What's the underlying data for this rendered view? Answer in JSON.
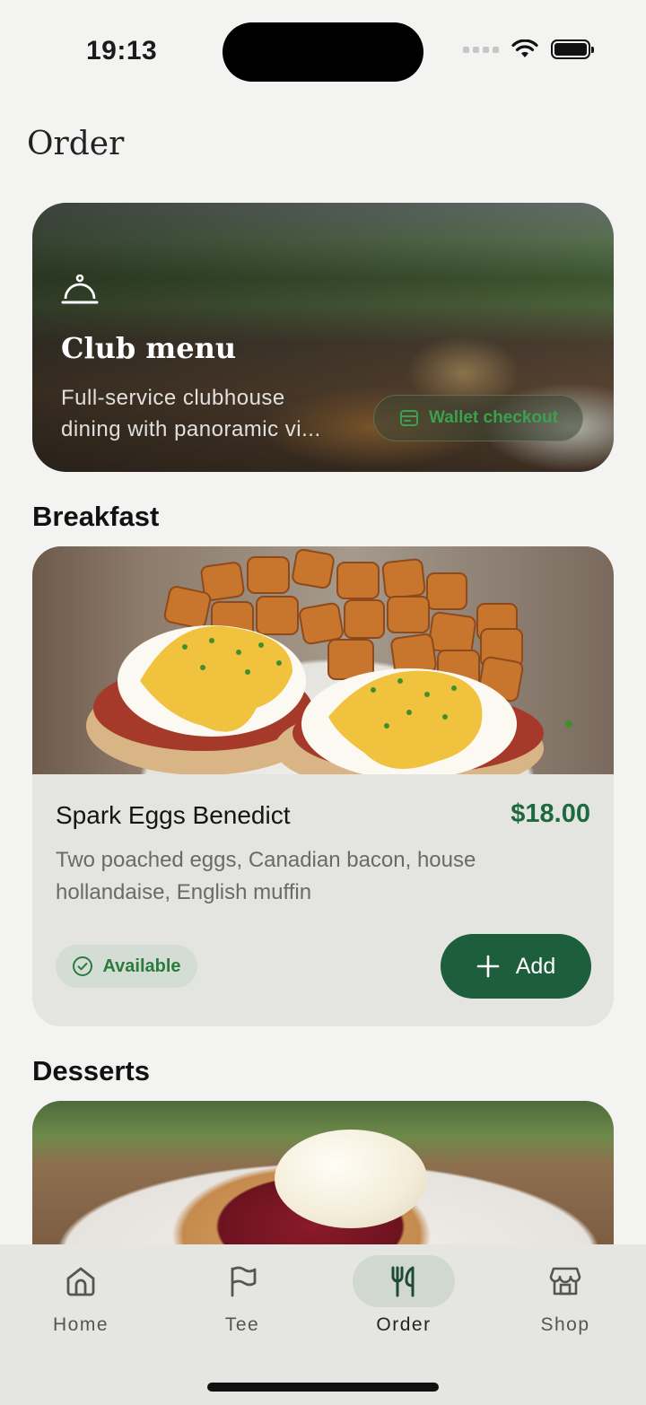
{
  "status_bar": {
    "time": "19:13"
  },
  "page": {
    "title": "Order"
  },
  "hero": {
    "icon": "service-bell-icon",
    "title": "Club menu",
    "description": "Full-service clubhouse dining with panoramic vi...",
    "wallet_button": "Wallet checkout"
  },
  "sections": [
    {
      "title": "Breakfast"
    },
    {
      "title": "Desserts"
    }
  ],
  "items": [
    {
      "name": "Spark Eggs Benedict",
      "price": "$18.00",
      "description": "Two poached eggs, Canadian bacon, house hollandaise, English muffin",
      "status": "Available",
      "add_label": "Add"
    }
  ],
  "nav": {
    "items": [
      {
        "label": "Home",
        "icon": "home-icon"
      },
      {
        "label": "Tee",
        "icon": "flag-icon"
      },
      {
        "label": "Order",
        "icon": "utensils-icon",
        "active": true
      },
      {
        "label": "Shop",
        "icon": "store-icon"
      }
    ]
  },
  "colors": {
    "accent": "#1d5e3c",
    "price": "#1e6a3f",
    "available": "#2c7a3e",
    "background": "#f3f4f1"
  }
}
